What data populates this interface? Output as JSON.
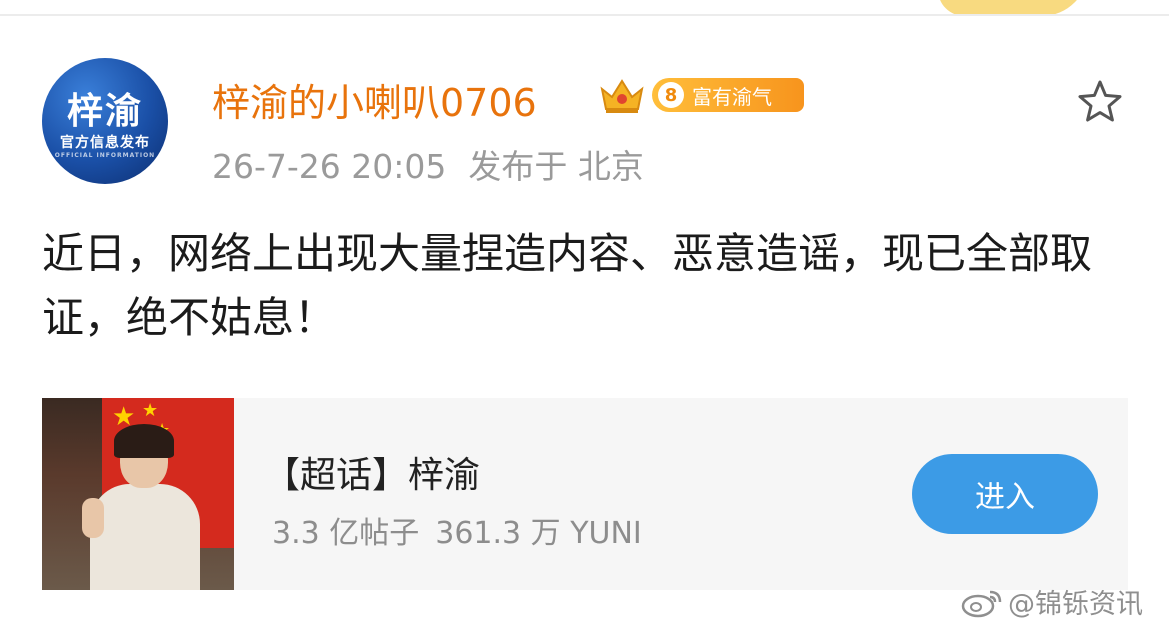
{
  "post": {
    "author": {
      "avatar_lines": [
        "梓渝",
        "官方信息发布",
        "OFFICIAL INFORMATION"
      ],
      "name": "梓渝的小喇叭0706",
      "crown_icon": "crown-icon",
      "level": "8",
      "badge_text": "富有渝气"
    },
    "timestamp": "26-7-26 20:05",
    "location": "发布于 北京",
    "body": "近日，网络上出现大量捏造内容、恶意造谣，现已全部取证，绝不姑息！",
    "favorite_icon": "star-icon"
  },
  "topic_card": {
    "title": "【超话】梓渝",
    "posts": "3.3 亿帖子",
    "followers": "361.3 万 YUNI",
    "enter_label": "进入"
  },
  "watermark": {
    "icon": "weibo-icon",
    "text": "@锦铄资讯"
  },
  "colors": {
    "username": "#e8730c",
    "badge": "#f7941d",
    "enter_button": "#3c9be6",
    "meta_text": "#9a9a9a",
    "card_bg": "#f6f6f6"
  }
}
